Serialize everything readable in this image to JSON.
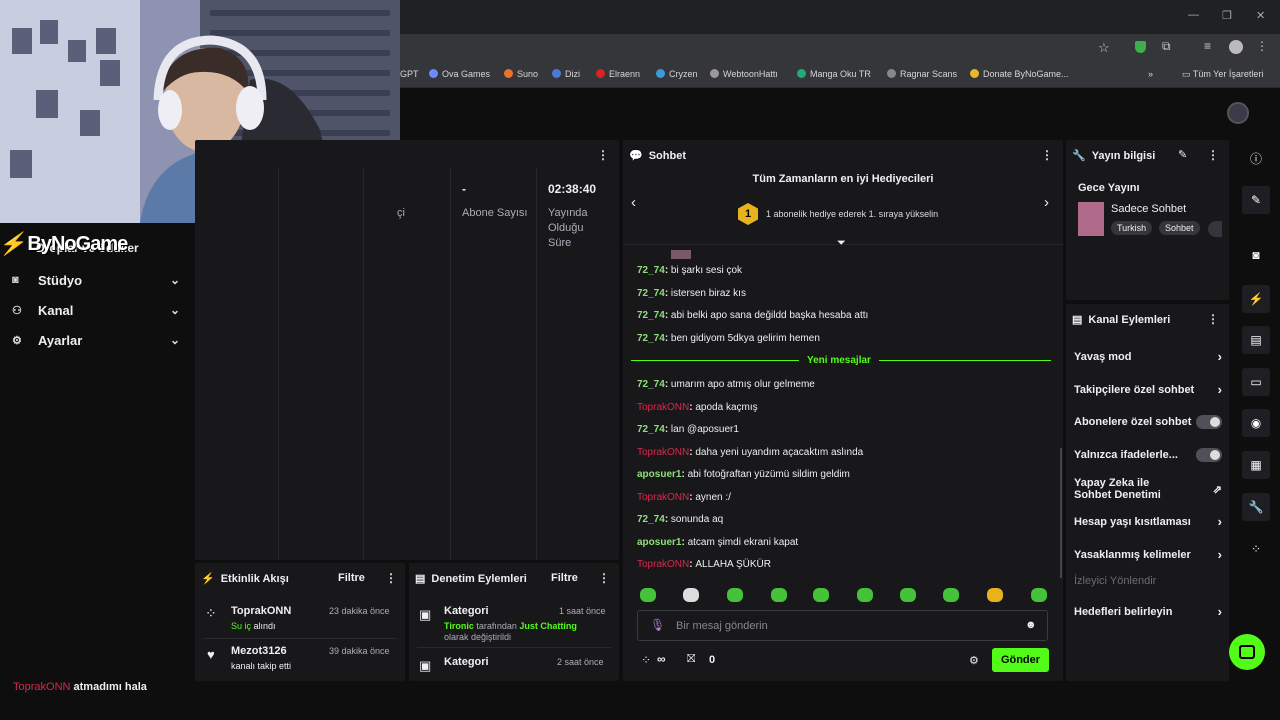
{
  "browser": {
    "bookmarks": [
      {
        "label": "GPT",
        "color": "#888"
      },
      {
        "label": "Ova Games",
        "color": "#6b8cff"
      },
      {
        "label": "Suno",
        "color": "#e8742c"
      },
      {
        "label": "Dizi",
        "color": "#4a7bd8"
      },
      {
        "label": "Elraenn",
        "color": "#d22"
      },
      {
        "label": "Cryzen",
        "color": "#3a9bd8"
      },
      {
        "label": "WebtoonHattı",
        "color": "#999"
      },
      {
        "label": "Manga Oku TR",
        "color": "#2a7"
      },
      {
        "label": "Ragnar Scans",
        "color": "#888"
      },
      {
        "label": "Donate ByNoGame...",
        "color": "#e8b82c"
      }
    ],
    "all_bookmarks": "Tüm Yer İşaretleri",
    "more": "»"
  },
  "brand": {
    "logo_text": "ByNoGame",
    "colors": {
      "accent": "#53fc18",
      "danger": "#d8284b",
      "panel": "#18181b",
      "bg": "#0e0e0e"
    }
  },
  "sidebar": {
    "partial_label": "Droplar ve ödüller",
    "items": [
      {
        "label": "Stüdyo",
        "icon": "studio-icon"
      },
      {
        "label": "Kanal",
        "icon": "channel-icon"
      },
      {
        "label": "Ayarlar",
        "icon": "gear-icon"
      }
    ]
  },
  "stats": {
    "partial_label": "çi",
    "abone": {
      "value": "-",
      "label": "Abone Sayısı"
    },
    "yayin": {
      "value": "02:38:40",
      "label": "Yayında Olduğu Süre"
    }
  },
  "chat": {
    "title": "Sohbet",
    "gifters_title": "Tüm Zamanların en iyi Hediyecileri",
    "gifters_rank": "1",
    "gifters_sub": "1 abonelik hediye ederek 1. sıraya yükselin",
    "new_messages": "Yeni mesajlar",
    "messages": [
      {
        "user": "72_74",
        "text": "bi şarkı sesi çok",
        "color": "g"
      },
      {
        "user": "72_74",
        "text": "istersen biraz kıs",
        "color": "g"
      },
      {
        "user": "72_74",
        "text": "abi belki apo sana değildd başka hesaba attı",
        "color": "g"
      },
      {
        "user": "72_74",
        "text": "ben gidiyom 5dkya gelirim hemen",
        "color": "g"
      },
      {
        "user": "72_74",
        "text": "umarım apo atmış olur gelmeme",
        "color": "g"
      },
      {
        "user": "ToprakONN",
        "text": "apoda kaçmış",
        "color": "r"
      },
      {
        "user": "72_74",
        "text": "lan @aposuer1",
        "color": "g"
      },
      {
        "user": "ToprakONN",
        "text": "daha yeni uyandım açacaktım aslında",
        "color": "r"
      },
      {
        "user": "aposuer1",
        "text": "abi fotoğraftan yüzümü sildim geldim",
        "color": "g"
      },
      {
        "user": "ToprakONN",
        "text": "aynen :/",
        "color": "r"
      },
      {
        "user": "72_74",
        "text": "sonunda aq",
        "color": "g"
      },
      {
        "user": "aposuer1",
        "text": "atcam şimdi ekrani kapat",
        "color": "g"
      },
      {
        "user": "ToprakONN",
        "text": "ALLAHA ŞÜKÜR",
        "color": "r"
      }
    ],
    "input_placeholder": "Bir mesaj gönderin",
    "points": "∞",
    "gift_count": "0",
    "send_label": "Gönder"
  },
  "info": {
    "title": "Yayın bilgisi",
    "stream_title": "Gece Yayını",
    "category": "Sadece Sohbet",
    "tags": [
      "Turkish",
      "Sohbet"
    ]
  },
  "actions": {
    "title": "Kanal Eylemleri",
    "items": [
      {
        "label": "Yavaş mod",
        "type": "chevron"
      },
      {
        "label": "Takipçilere özel sohbet",
        "type": "chevron"
      },
      {
        "label": "Abonelere özel sohbet",
        "type": "toggle"
      },
      {
        "label": "Yalnızca ifadelerle...",
        "type": "toggle"
      },
      {
        "label": "Yapay Zeka ile Sohbet Denetimi",
        "type": "external"
      },
      {
        "label": "Hesap yaşı kısıtlaması",
        "type": "chevron"
      },
      {
        "label": "Yasaklanmış kelimeler",
        "type": "chevron"
      },
      {
        "label": "İzleyici Yönlendir",
        "type": "disabled"
      },
      {
        "label": "Hedefleri belirleyin",
        "type": "chevron"
      }
    ]
  },
  "activity": {
    "title": "Etkinlik Akışı",
    "filter": "Filtre",
    "items": [
      {
        "user": "ToprakONN",
        "time": "23 dakika önce",
        "action_green": "Su iç",
        "action_rest": "alındı",
        "icon": "points-icon"
      },
      {
        "user": "Mezot3126",
        "time": "39 dakika önce",
        "action_green": "",
        "action_rest": "kanalı takip etti",
        "icon": "heart-icon"
      }
    ]
  },
  "moderation": {
    "title": "Denetim Eylemleri",
    "filter": "Filtre",
    "items": [
      {
        "title": "Kategori",
        "time": "1 saat önce",
        "actor": "Tironic",
        "middle": "tarafından",
        "target": "Just Chatting",
        "suffix": "olarak değiştirildi"
      },
      {
        "title": "Kategori",
        "time": "2 saat önce"
      }
    ]
  },
  "overlay": {
    "user": "ToprakONN",
    "text": "atmadımı hala"
  }
}
